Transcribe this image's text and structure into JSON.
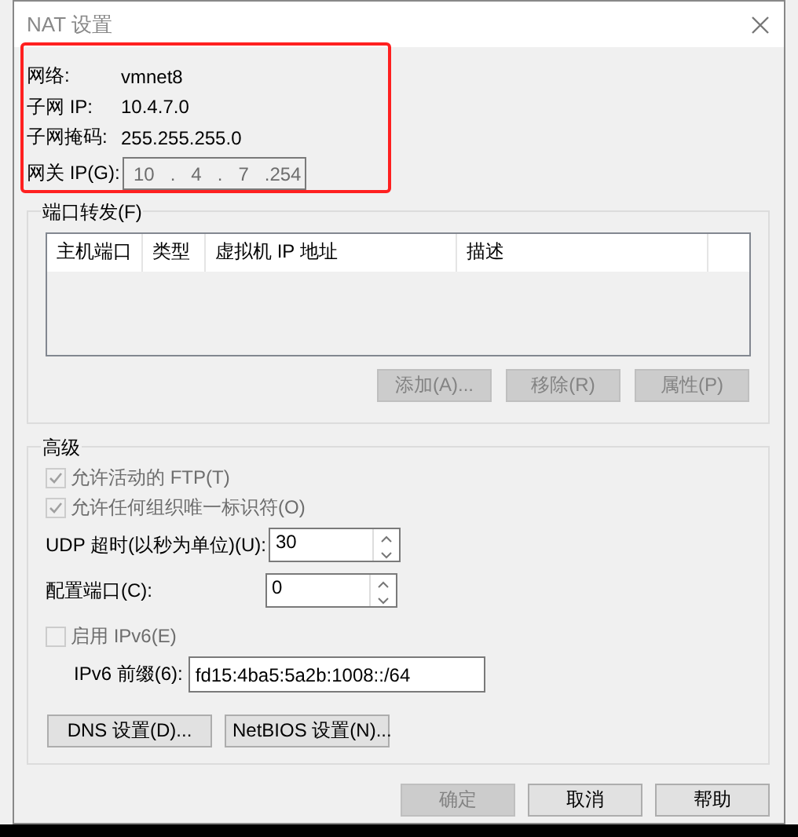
{
  "window": {
    "title": "NAT 设置"
  },
  "info": [
    {
      "label": "网络:",
      "value": "vmnet8"
    },
    {
      "label": "子网 IP:",
      "value": "10.4.7.0"
    },
    {
      "label": "子网掩码:",
      "value": "255.255.255.0"
    }
  ],
  "gateway": {
    "label": "网关 IP(G):",
    "value": "10   .   4   .   7   .254"
  },
  "port_forwarding": {
    "title": "端口转发(F)",
    "columns": [
      "主机端口",
      "类型",
      "虚拟机 IP 地址",
      "描述"
    ],
    "buttons": [
      {
        "label": "添加(A)...",
        "disabled": true
      },
      {
        "label": "移除(R)",
        "disabled": true
      },
      {
        "label": "属性(P)",
        "disabled": true
      }
    ]
  },
  "advanced": {
    "title": "高级",
    "options": [
      {
        "label": "允许活动的 FTP(T)",
        "checked": true,
        "disabled": true
      },
      {
        "label": "允许任何组织唯一标识符(O)",
        "checked": true,
        "disabled": true
      }
    ],
    "spinners": [
      {
        "label": "UDP 超时(以秒为单位)(U):",
        "value": "30"
      },
      {
        "label": "配置端口(C):",
        "value": "0"
      }
    ],
    "ipv6": {
      "label": "启用 IPv6(E)",
      "checked": false,
      "disabled": true
    },
    "ipv6_prefix": {
      "label": "IPv6 前缀(6):",
      "value": "fd15:4ba5:5a2b:1008::/64"
    },
    "buttons": [
      {
        "label": "DNS 设置(D)...",
        "disabled": false
      },
      {
        "label": "NetBIOS 设置(N)...",
        "disabled": false
      }
    ]
  },
  "footer_buttons": [
    {
      "label": "确定",
      "disabled": true
    },
    {
      "label": "取消",
      "disabled": false
    },
    {
      "label": "帮助",
      "disabled": false
    }
  ]
}
